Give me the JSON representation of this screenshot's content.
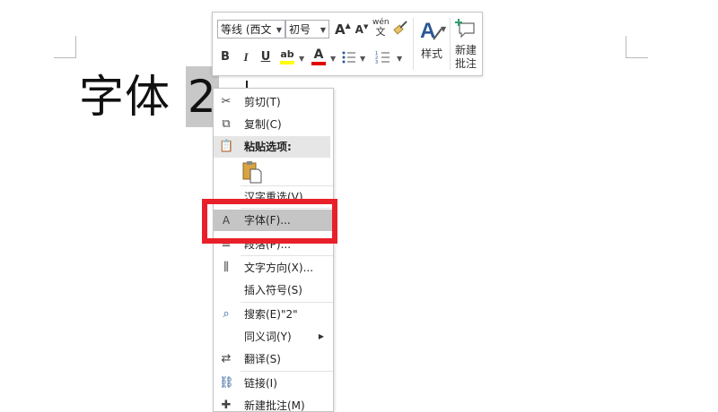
{
  "document": {
    "text_main": "字体 ",
    "text_selected": "2"
  },
  "mini_toolbar": {
    "font_name": "等线 (西文",
    "font_size": "初号",
    "grow_font": "A",
    "shrink_font": "A",
    "phonetic_top": "wén",
    "phonetic_bottom": "文",
    "bold": "B",
    "italic": "I",
    "underline": "U",
    "highlight_letter": "ab",
    "font_color_letter": "A",
    "styles_label": "样式",
    "new_comment_label_line1": "新建",
    "new_comment_label_line2": "批注",
    "highlight_color": "#ffff00",
    "font_color": "#e00000"
  },
  "context_menu": {
    "items": [
      {
        "label": "剪切(T)"
      },
      {
        "label": "复制(C)"
      },
      {
        "label": "粘贴选项:"
      },
      {
        "label": "汉字重选(V)"
      },
      {
        "label": "字体(F)..."
      },
      {
        "label": "段落(P)..."
      },
      {
        "label": "文字方向(X)..."
      },
      {
        "label": "插入符号(S)"
      },
      {
        "label": "搜索(E)\"2\""
      },
      {
        "label": "同义词(Y)"
      },
      {
        "label": "翻译(S)"
      },
      {
        "label": "链接(I)"
      },
      {
        "label": "新建批注(M)"
      }
    ],
    "font_item_icon": "A"
  },
  "colors": {
    "highlight_border": "#e8202a",
    "menu_hover": "#c5c5c5"
  }
}
